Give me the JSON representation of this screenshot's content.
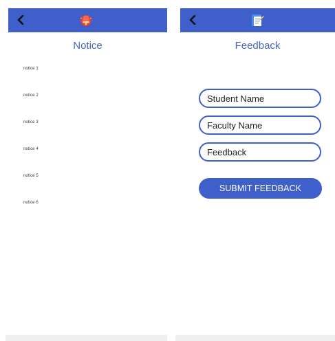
{
  "notice_screen": {
    "title": "Notice",
    "icon": "bell-icon",
    "notices": [
      "notice 1",
      "notice 2",
      "notice 3",
      "notice 4",
      "notice 5",
      "notice 6"
    ]
  },
  "feedback_screen": {
    "title": "Feedback",
    "icon": "notepad-icon",
    "student_name": "Student Name",
    "faculty_name": "Faculty Name",
    "feedback": "Feedback",
    "submit_label": "SUBMIT FEEDBACK"
  },
  "colors": {
    "appbar": "#3f5fcb",
    "title": "#4a64b8",
    "button": "#3f5fcb"
  }
}
